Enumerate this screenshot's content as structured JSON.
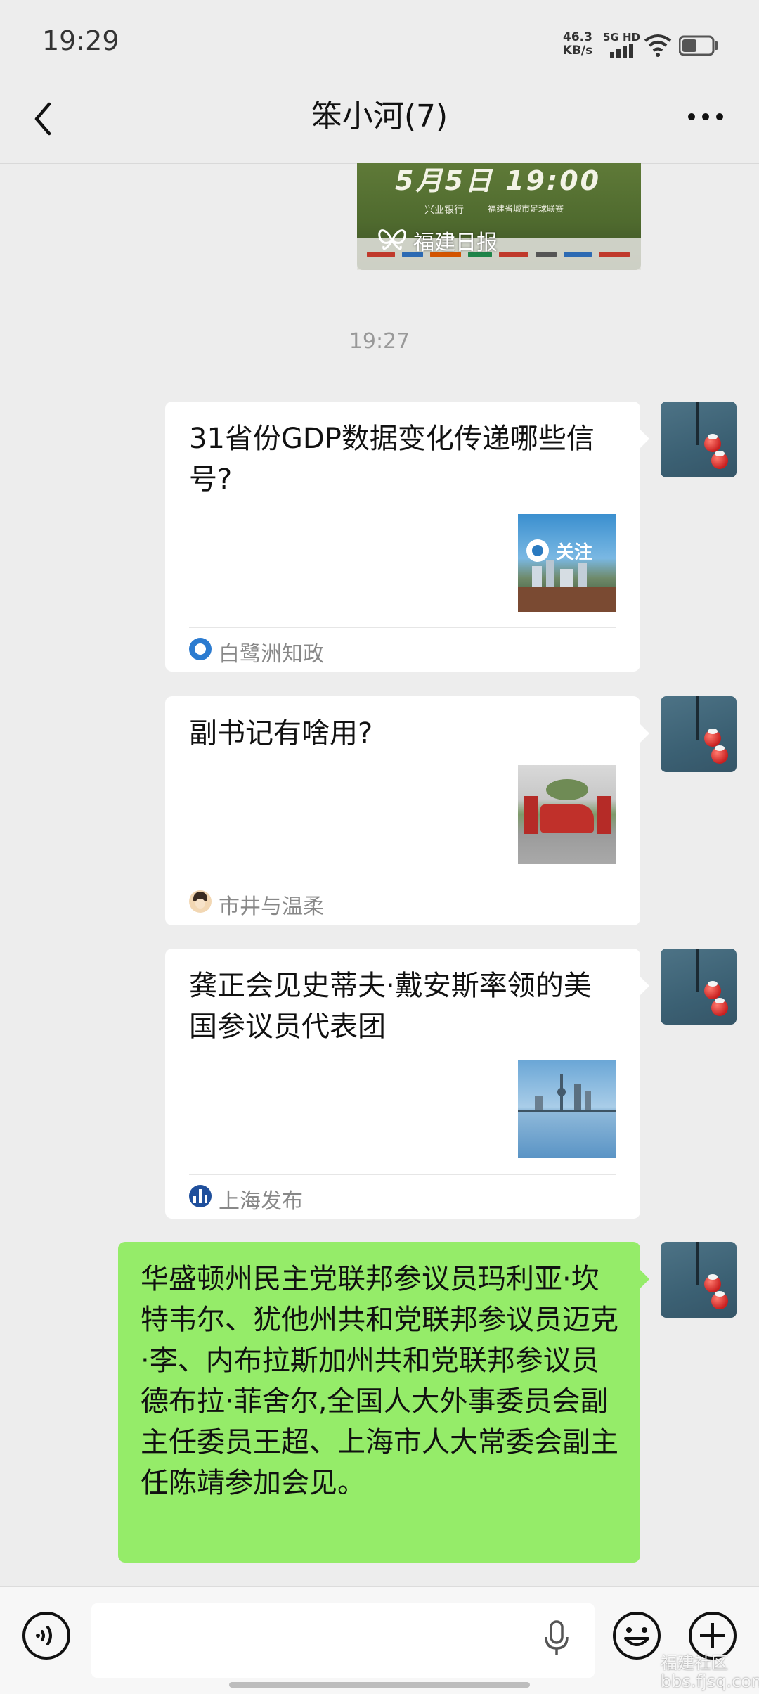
{
  "status_bar": {
    "time": "19:29",
    "net_speed_value": "46.3",
    "net_speed_unit": "KB/s",
    "network_type": "5G HD",
    "signal_icon": "signal-icon",
    "wifi_icon": "wifi-icon",
    "battery_icon": "battery-icon"
  },
  "nav": {
    "title": "笨小河(7)",
    "back_icon": "chevron-left-icon",
    "more_icon": "more-horizontal-icon"
  },
  "video_card": {
    "headline": "5月5日 19:00",
    "sponsor_1": "兴业银行",
    "sponsor_2": "福建省城市足球联赛",
    "source": "福建日报"
  },
  "chat": {
    "timestamp": "19:27",
    "articles": [
      {
        "title": "31省份GDP数据变化传递哪些信号?",
        "thumb_label": "关注",
        "source": "白鹭洲知政"
      },
      {
        "title": "副书记有啥用?",
        "source": "市井与温柔"
      },
      {
        "title": "龚正会见史蒂夫·戴安斯率领的美国参议员代表团",
        "source": "上海发布"
      }
    ],
    "text_message": "华盛顿州民主党联邦参议员玛利亚·坎特韦尔、犹他州共和党联邦参议员迈克·李、内布拉斯加州共和党联邦参议员德布拉·菲舍尔,全国人大外事委员会副主任委员王超、上海市人大常委会副主任陈靖参加会见。"
  },
  "input_bar": {
    "voice_icon": "voice-icon",
    "message_placeholder": "",
    "mic_icon": "microphone-icon",
    "emoji_icon": "emoji-icon",
    "plus_icon": "plus-icon"
  },
  "colors": {
    "background": "#ededed",
    "self_bubble": "#95ec69",
    "card": "#ffffff",
    "secondary_text": "#888888"
  },
  "watermark": "福建社区 bbs.fjsq.com"
}
